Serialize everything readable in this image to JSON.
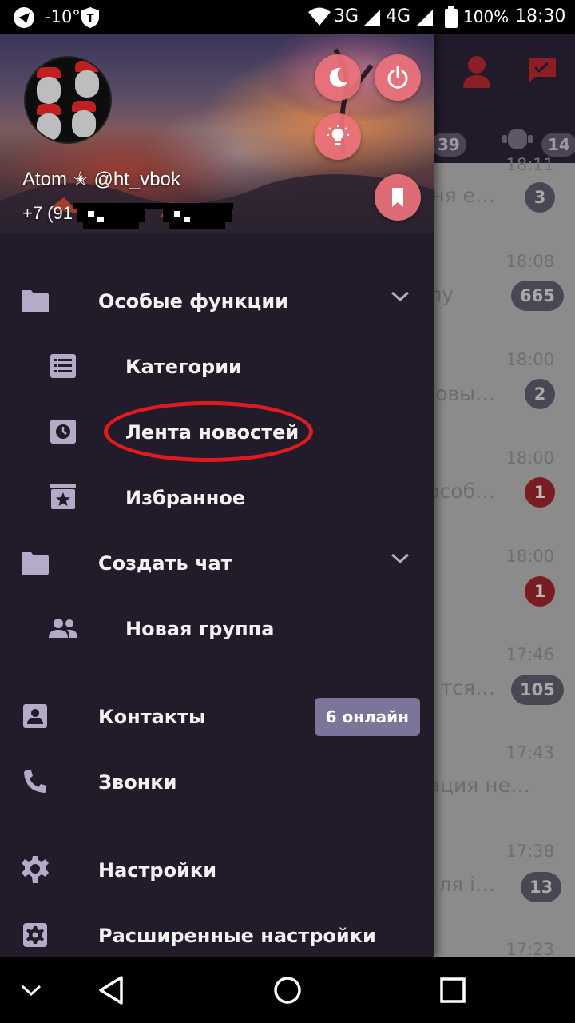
{
  "status_bar": {
    "temperature": "-10°",
    "net_3g": "3G",
    "net_4g": "4G",
    "battery": "100%",
    "time": "18:30",
    "icons": [
      "telegram-icon",
      "shield-t-icon",
      "wifi-icon",
      "signal-icon",
      "battery-icon"
    ]
  },
  "drawer": {
    "header": {
      "user_name": "Atom ✭ @ht_vbok",
      "phone": "+7 (91",
      "buttons": [
        "night-mode-icon",
        "power-icon",
        "lightbulb-icon",
        "bookmark-icon"
      ]
    },
    "sections": [
      {
        "label": "Особые функции",
        "icon": "folder-icon",
        "expanded": true,
        "children": [
          {
            "label": "Категории",
            "icon": "list-icon"
          },
          {
            "label": "Лента новостей",
            "icon": "news-feed-icon"
          },
          {
            "label": "Избранное",
            "icon": "favorites-icon"
          }
        ]
      },
      {
        "label": "Создать чат",
        "icon": "folder-icon",
        "expanded": true,
        "children": [
          {
            "label": "Новая группа",
            "icon": "group-icon"
          }
        ]
      }
    ],
    "items": [
      {
        "label": "Контакты",
        "icon": "contact-icon",
        "badge": "6 онлайн"
      },
      {
        "label": "Звонки",
        "icon": "phone-icon"
      },
      {
        "label": "Настройки",
        "icon": "settings-icon"
      },
      {
        "label": "Расширенные настройки",
        "icon": "advanced-settings-icon"
      }
    ]
  },
  "background_chats": {
    "top_badges": [
      "39",
      "14"
    ],
    "rows": [
      {
        "time": "18:11",
        "snippet": "дня е…",
        "badge": "3",
        "badge_color": "dark"
      },
      {
        "time": "18:08",
        "snippet": "лу",
        "badge": "665",
        "badge_color": "dark"
      },
      {
        "time": "18:00",
        "snippet": "новы…",
        "badge": "2",
        "badge_color": "dark"
      },
      {
        "time": "18:00",
        "snippet": "особ…",
        "badge": "1",
        "badge_color": "red"
      },
      {
        "time": "18:00",
        "snippet": "",
        "badge": "1",
        "badge_color": "red"
      },
      {
        "time": "17:46",
        "snippet": "тся…",
        "badge": "105",
        "badge_color": "dark"
      },
      {
        "time": "17:43",
        "snippet": "ация не…",
        "badge": "",
        "badge_color": "dark"
      },
      {
        "time": "17:38",
        "snippet": "ля і…",
        "badge": "13",
        "badge_color": "dark"
      },
      {
        "time": "17:23",
        "snippet": "",
        "badge": "",
        "badge_color": "dark"
      }
    ]
  },
  "nav_bar": {
    "buttons": [
      "chevron-down-icon",
      "back-icon",
      "home-icon",
      "recents-icon"
    ]
  },
  "colors": {
    "drawer_bg": "#211b2a",
    "header_button": "#ec727c",
    "badge_bg": "#7d749a",
    "highlight": "#e11a1f"
  }
}
